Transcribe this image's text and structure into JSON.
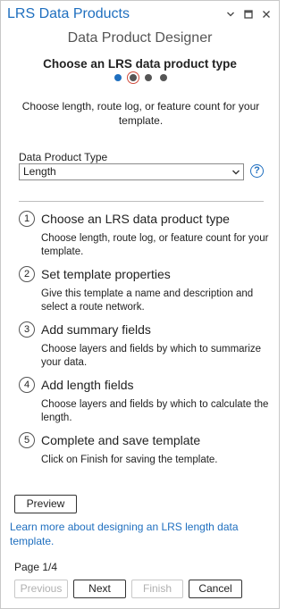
{
  "window": {
    "title": "LRS Data Products",
    "controls": [
      "chevron-down-icon",
      "maximize-icon",
      "close-icon"
    ]
  },
  "header": {
    "title": "Data Product Designer",
    "step_heading": "Choose an LRS data product type",
    "progress": {
      "current": 1,
      "total": 4
    }
  },
  "main": {
    "description": "Choose length, route log, or feature count for your template.",
    "product_type": {
      "label": "Data Product Type",
      "value": "Length"
    },
    "steps": [
      {
        "num": "1",
        "title": "Choose an LRS data product type",
        "desc": "Choose length, route log, or feature count for your template."
      },
      {
        "num": "2",
        "title": "Set template properties",
        "desc": "Give this template a name and description and select a route network."
      },
      {
        "num": "3",
        "title": "Add summary fields",
        "desc": "Choose layers and fields by which to summarize your data."
      },
      {
        "num": "4",
        "title": "Add length fields",
        "desc": "Choose layers and fields by which to calculate the length."
      },
      {
        "num": "5",
        "title": "Complete and save template",
        "desc": "Click on Finish for saving the template."
      }
    ]
  },
  "footer": {
    "preview_label": "Preview",
    "learn_more": "Learn more about designing an LRS length data template.",
    "page": "Page 1/4",
    "previous_label": "Previous",
    "next_label": "Next",
    "finish_label": "Finish",
    "cancel_label": "Cancel"
  },
  "colors": {
    "accent": "#1f6fbf",
    "active_ring": "#d04a3c"
  }
}
